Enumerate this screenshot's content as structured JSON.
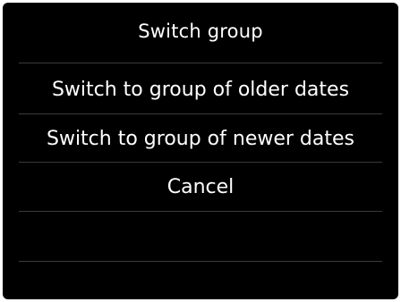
{
  "dialog": {
    "title": "Switch group",
    "items": [
      {
        "label": "Switch to group of older dates"
      },
      {
        "label": "Switch to group of newer dates"
      },
      {
        "label": "Cancel"
      },
      {
        "label": ""
      },
      {
        "label": ""
      }
    ]
  }
}
